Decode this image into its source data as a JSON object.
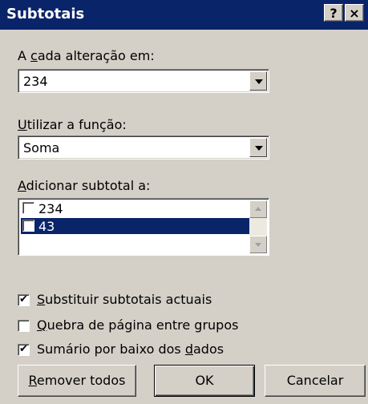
{
  "window": {
    "title": "Subtotais",
    "help_label": "?",
    "close_label": "×"
  },
  "group_by": {
    "label_prefix": "A ",
    "label_accel": "c",
    "label_suffix": "ada alteração em:",
    "value": "234"
  },
  "function": {
    "label_accel": "U",
    "label_suffix": "tilizar a função:",
    "value": "Soma"
  },
  "add_subtotal": {
    "label_accel": "A",
    "label_suffix": "dicionar subtotal a:",
    "items": [
      {
        "label": "234",
        "checked": false,
        "selected": false
      },
      {
        "label": "43",
        "checked": true,
        "selected": true
      }
    ]
  },
  "options": {
    "replace": {
      "accel": "S",
      "rest": "ubstituir subtotais actuais",
      "checked": true
    },
    "page_break": {
      "accel": "Q",
      "rest": "uebra de página entre grupos",
      "checked": false
    },
    "summary": {
      "before": "Sumário por baixo dos ",
      "accel": "d",
      "after": "ados",
      "checked": true
    }
  },
  "buttons": {
    "remove_all": {
      "accel": "R",
      "rest": "emover todos"
    },
    "ok": "OK",
    "cancel": "Cancelar"
  },
  "check_mark": "✔",
  "colors": {
    "title_bar": "#0a246a",
    "face": "#d4d0c8",
    "selection": "#0a246a"
  }
}
